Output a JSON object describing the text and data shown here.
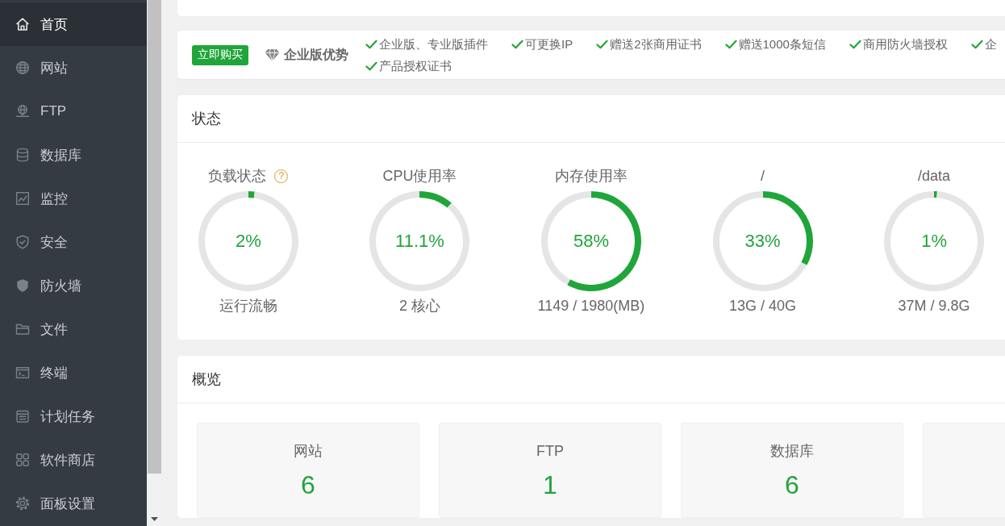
{
  "sidebar": {
    "items": [
      {
        "label": "首页",
        "selected": true
      },
      {
        "label": "网站",
        "selected": false
      },
      {
        "label": "FTP",
        "selected": false
      },
      {
        "label": "数据库",
        "selected": false
      },
      {
        "label": "监控",
        "selected": false
      },
      {
        "label": "安全",
        "selected": false
      },
      {
        "label": "防火墙",
        "selected": false
      },
      {
        "label": "文件",
        "selected": false
      },
      {
        "label": "终端",
        "selected": false
      },
      {
        "label": "计划任务",
        "selected": false
      },
      {
        "label": "软件商店",
        "selected": false
      },
      {
        "label": "面板设置",
        "selected": false
      }
    ]
  },
  "promo": {
    "buy_button": "立即购买",
    "title": "企业版优势",
    "features": [
      "企业版、专业版插件",
      "可更换IP",
      "赠送2张商用证书",
      "赠送1000条短信",
      "商用防火墙授权",
      "企",
      "产品授权证书"
    ]
  },
  "status": {
    "title": "状态",
    "gauges": [
      {
        "title": "负载状态",
        "help": "?",
        "value": "2%",
        "detail": "运行流畅",
        "chart_data": {
          "type": "donut",
          "values": [
            2,
            98
          ],
          "colors": [
            "#20a53a",
            "#e5e5e5"
          ]
        }
      },
      {
        "title": "CPU使用率",
        "value": "11.1%",
        "detail": "2 核心",
        "chart_data": {
          "type": "donut",
          "values": [
            11.1,
            88.9
          ],
          "colors": [
            "#20a53a",
            "#e5e5e5"
          ]
        }
      },
      {
        "title": "内存使用率",
        "value": "58%",
        "detail": "1149 / 1980(MB)",
        "chart_data": {
          "type": "donut",
          "values": [
            58,
            42
          ],
          "colors": [
            "#20a53a",
            "#e5e5e5"
          ]
        }
      },
      {
        "title": "/",
        "value": "33%",
        "detail": "13G / 40G",
        "chart_data": {
          "type": "donut",
          "values": [
            33,
            67
          ],
          "colors": [
            "#20a53a",
            "#e5e5e5"
          ]
        }
      },
      {
        "title": "/data",
        "value": "1%",
        "detail": "37M / 9.8G",
        "chart_data": {
          "type": "donut",
          "values": [
            1,
            99
          ],
          "colors": [
            "#20a53a",
            "#e5e5e5"
          ]
        }
      }
    ]
  },
  "overview": {
    "title": "概览",
    "tiles": [
      {
        "label": "网站",
        "count": "6"
      },
      {
        "label": "FTP",
        "count": "1"
      },
      {
        "label": "数据库",
        "count": "6"
      }
    ]
  }
}
